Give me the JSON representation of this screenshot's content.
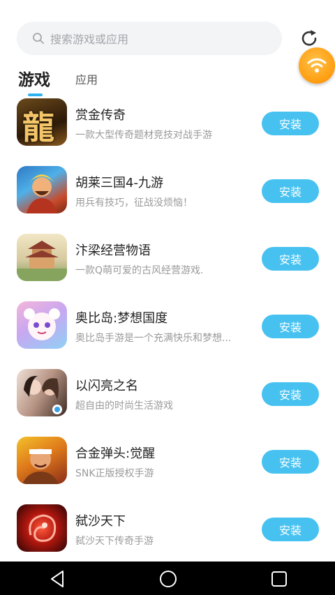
{
  "search": {
    "placeholder": "搜索游戏或应用"
  },
  "tabs": [
    {
      "label": "游戏",
      "active": true
    },
    {
      "label": "应用",
      "active": false
    }
  ],
  "install_label": "安装",
  "apps": [
    {
      "name": "赏金传奇",
      "desc": "一款大型传奇题材竞技对战手游"
    },
    {
      "name": "胡莱三国4-九游",
      "desc": "用兵有技巧，征战没烦恼！"
    },
    {
      "name": "汴梁经营物语",
      "desc": "一款Q萌可爱的古风经营游戏."
    },
    {
      "name": "奥比岛:梦想国度",
      "desc": "奥比岛手游是一个充满快乐和梦想..."
    },
    {
      "name": "以闪亮之名",
      "desc": "超自由的时尚生活游戏"
    },
    {
      "name": "合金弹头:觉醒",
      "desc": "SNK正版授权手游"
    },
    {
      "name": "弑沙天下",
      "desc": "弑沙天下传奇手游"
    }
  ],
  "icon_glyphs": {
    "long": "龍"
  },
  "colors": {
    "accent": "#47c2f0",
    "tab_underline": "#2fb3f0",
    "float_button": "#ff9f13"
  }
}
